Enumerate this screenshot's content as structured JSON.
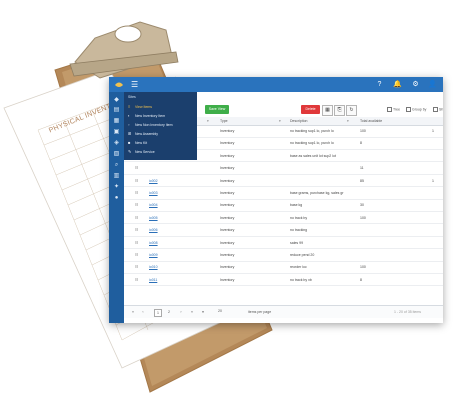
{
  "clipboard": {
    "sheet_title": "PHYSICAL INVENTORY COUNT SHEET"
  },
  "menu": {
    "heading": "Sites",
    "items": [
      {
        "label": "View Items",
        "icon": "list-icon",
        "active": true
      },
      {
        "label": "New Inventory Item",
        "icon": "cube-icon",
        "active": false
      },
      {
        "label": "New Non Inventory Item",
        "icon": "cubes-icon",
        "active": false
      },
      {
        "label": "New Assembly",
        "icon": "sitemap-icon",
        "active": false
      },
      {
        "label": "New Kit",
        "icon": "box-icon",
        "active": false
      },
      {
        "label": "New Service",
        "icon": "wrench-icon",
        "active": false
      }
    ]
  },
  "toolbar": {
    "save_label": "Save View",
    "delete_label": "Delete",
    "tree_label": "Tree",
    "group_label": "Group by",
    "show_label": "Sh"
  },
  "grid": {
    "headers": [
      "Type",
      "Description",
      "Total available"
    ],
    "rows": [
      {
        "name": "",
        "type": "Inventory",
        "desc": "no tracking sup1 lo, purch lo",
        "avail": "100",
        "extra": "1"
      },
      {
        "name": "",
        "type": "Inventory",
        "desc": "no tracking sup1 lo, purch lo",
        "avail": "8",
        "extra": ""
      },
      {
        "name": "",
        "type": "Inventory",
        "desc": "base as sales unit lot sup2 lot",
        "avail": "",
        "extra": ""
      },
      {
        "name": "",
        "type": "Inventory",
        "desc": "",
        "avail": "11",
        "extra": ""
      },
      {
        "name": "io002",
        "type": "Inventory",
        "desc": "",
        "avail": "85",
        "extra": "1"
      },
      {
        "name": "io003",
        "type": "Inventory",
        "desc": "base grams, purchase kg, sales gr",
        "avail": "",
        "extra": ""
      },
      {
        "name": "io004",
        "type": "Inventory",
        "desc": "base kg",
        "avail": "30",
        "extra": ""
      },
      {
        "name": "io005",
        "type": "Inventory",
        "desc": "no track by",
        "avail": "100",
        "extra": ""
      },
      {
        "name": "io006",
        "type": "Inventory",
        "desc": "no tracking",
        "avail": "",
        "extra": ""
      },
      {
        "name": "io008",
        "type": "Inventory",
        "desc": "sales 99",
        "avail": "",
        "extra": ""
      },
      {
        "name": "io009",
        "type": "Inventory",
        "desc": "reduce pend 20",
        "avail": "",
        "extra": ""
      },
      {
        "name": "io010",
        "type": "Inventory",
        "desc": "reorder loc",
        "avail": "100",
        "extra": ""
      },
      {
        "name": "io011",
        "type": "Inventory",
        "desc": "no track by xb",
        "avail": "8",
        "extra": ""
      }
    ]
  },
  "pager": {
    "pages": [
      "1",
      "2"
    ],
    "per_page": "20",
    "per_page_label": "items per page",
    "count": "1 - 20 of 35 items"
  }
}
